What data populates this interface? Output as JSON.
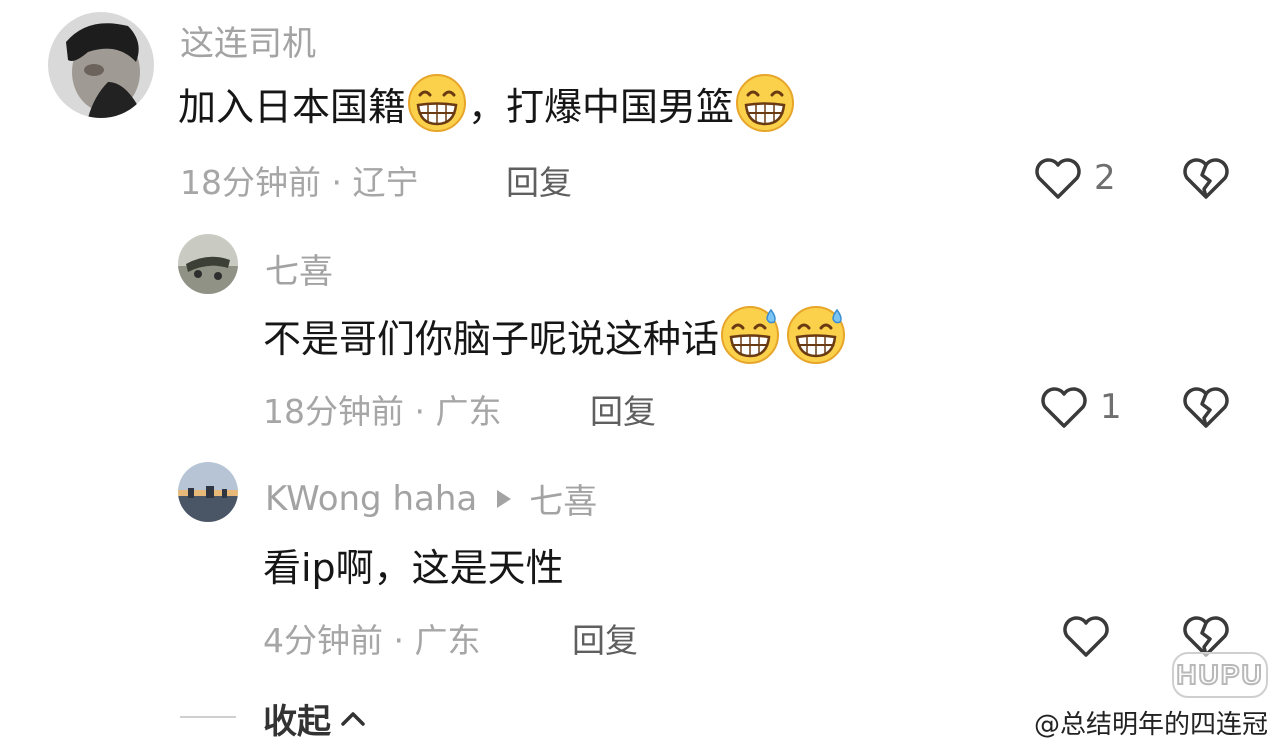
{
  "comments": [
    {
      "username": "这连司机",
      "text_part1": "加入日本国籍",
      "text_part2": "，打爆中国男篮",
      "emoji": "grin-emoji",
      "time": "18分钟前",
      "sep": "·",
      "location": "辽宁",
      "reply_label": "回复",
      "likes": "2"
    },
    {
      "username": "七喜",
      "text": "不是哥们你脑子呢说这种话",
      "emoji": "sweat-grin-emoji",
      "time": "18分钟前",
      "sep": "·",
      "location": "广东",
      "reply_label": "回复",
      "likes": "1"
    },
    {
      "username": "KWong haha",
      "reply_to": "七喜",
      "text": "看ip啊，这是天性",
      "time": "4分钟前",
      "sep": "·",
      "location": "广东",
      "reply_label": "回复",
      "likes": ""
    }
  ],
  "collapse_label": "收起",
  "watermark": {
    "logo": "HUPU",
    "handle": "@总结明年的四连冠"
  },
  "colors": {
    "heart": "#3a3a3a",
    "meta": "#a6a6a6"
  }
}
